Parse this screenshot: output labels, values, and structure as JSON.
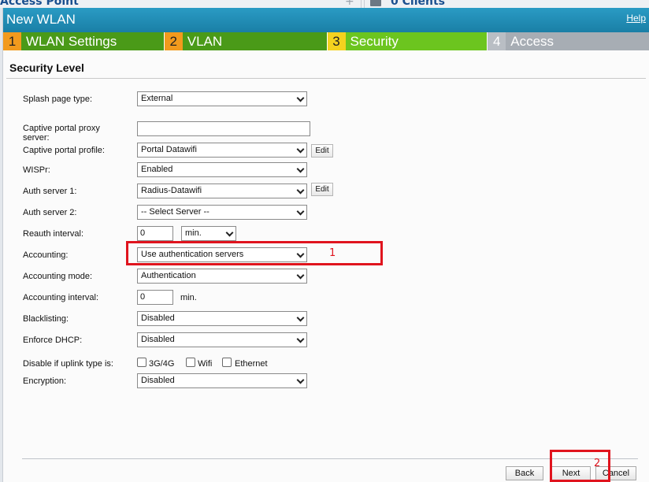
{
  "background": {
    "left_title": "Access Point",
    "plus": "+",
    "clients_label": "0 Clients"
  },
  "dialog": {
    "title": "New WLAN",
    "help": "Help"
  },
  "steps": [
    {
      "num": "1",
      "label": "WLAN Settings"
    },
    {
      "num": "2",
      "label": "VLAN"
    },
    {
      "num": "3",
      "label": "Security"
    },
    {
      "num": "4",
      "label": "Access"
    }
  ],
  "section_title": "Security Level",
  "form": {
    "splash_page_type": {
      "label": "Splash page type:",
      "value": "External"
    },
    "captive_proxy": {
      "label": "Captive portal proxy server:",
      "value": ""
    },
    "captive_profile": {
      "label": "Captive portal profile:",
      "value": "Portal Datawifi",
      "edit": "Edit"
    },
    "wispr": {
      "label": "WISPr:",
      "value": "Enabled"
    },
    "auth_server_1": {
      "label": "Auth server 1:",
      "value": "Radius-Datawifi",
      "edit": "Edit"
    },
    "auth_server_2": {
      "label": "Auth server 2:",
      "value": "-- Select Server --"
    },
    "reauth_interval": {
      "label": "Reauth interval:",
      "value": "0",
      "unit": "min."
    },
    "accounting": {
      "label": "Accounting:",
      "value": "Use authentication servers"
    },
    "accounting_mode": {
      "label": "Accounting mode:",
      "value": "Authentication"
    },
    "accounting_interval": {
      "label": "Accounting interval:",
      "value": "0",
      "unit": "min."
    },
    "blacklisting": {
      "label": "Blacklisting:",
      "value": "Disabled"
    },
    "enforce_dhcp": {
      "label": "Enforce DHCP:",
      "value": "Disabled"
    },
    "disable_uplink": {
      "label": "Disable if uplink type is:",
      "options": [
        "3G/4G",
        "Wifi",
        "Ethernet"
      ]
    },
    "encryption": {
      "label": "Encryption:",
      "value": "Disabled"
    }
  },
  "annotations": {
    "one": "1",
    "two": "2"
  },
  "buttons": {
    "back": "Back",
    "next": "Next",
    "cancel": "Cancel"
  },
  "colors": {
    "annotation_red": "#e0141e",
    "titlebar": "#1a7fa6",
    "step_active": "#6cc51f"
  }
}
